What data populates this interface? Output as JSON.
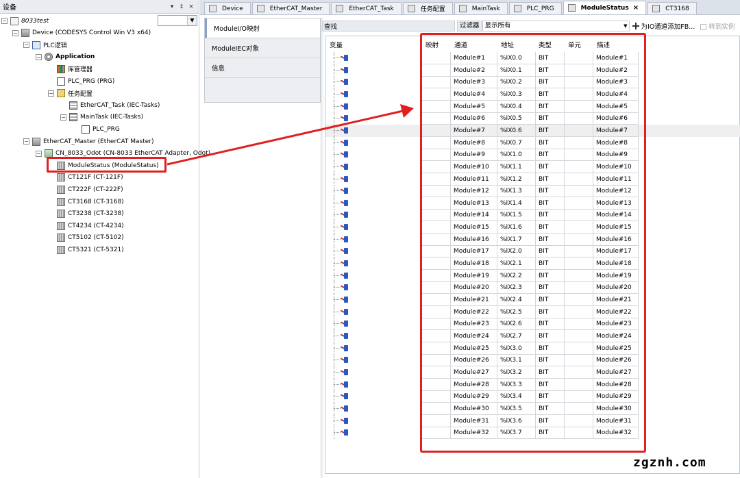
{
  "device_pane": {
    "title": "设备",
    "controls": [
      "▾",
      "‡",
      "×"
    ]
  },
  "tree": [
    {
      "label": "8033test",
      "expander": "−",
      "icon": "project",
      "italic": true
    },
    {
      "label": "Device (CODESYS Control Win V3 x64)",
      "expander": "−",
      "icon": "device"
    },
    {
      "label": "PLC逻辑",
      "expander": "−",
      "icon": "plc-logic"
    },
    {
      "label": "Application",
      "expander": "−",
      "icon": "application",
      "bold": true
    },
    {
      "label": "库管理器",
      "expander": "",
      "icon": "library"
    },
    {
      "label": "PLC_PRG (PRG)",
      "expander": "",
      "icon": "pou"
    },
    {
      "label": "任务配置",
      "expander": "−",
      "icon": "task-config"
    },
    {
      "label": "EtherCAT_Task (IEC-Tasks)",
      "expander": "",
      "icon": "task"
    },
    {
      "label": "MainTask (IEC-Tasks)",
      "expander": "−",
      "icon": "task"
    },
    {
      "label": "PLC_PRG",
      "expander": "",
      "icon": "pou-call"
    },
    {
      "label": "EtherCAT_Master (EtherCAT Master)",
      "expander": "−",
      "icon": "ethercat-master"
    },
    {
      "label": "CN_8033_Odot (CN-8033 EtherCAT Adapter, Odot)",
      "expander": "−",
      "icon": "slave"
    },
    {
      "label": "ModuleStatus (ModuleStatus)",
      "expander": "",
      "icon": "module"
    },
    {
      "label": "CT121F (CT-121F)",
      "expander": "",
      "icon": "module"
    },
    {
      "label": "CT222F (CT-222F)",
      "expander": "",
      "icon": "module"
    },
    {
      "label": "CT3168 (CT-3168)",
      "expander": "",
      "icon": "module"
    },
    {
      "label": "CT3238 (CT-3238)",
      "expander": "",
      "icon": "module"
    },
    {
      "label": "CT4234 (CT-4234)",
      "expander": "",
      "icon": "module"
    },
    {
      "label": "CT5102 (CT-5102)",
      "expander": "",
      "icon": "module"
    },
    {
      "label": "CT5321 (CT-5321)",
      "expander": "",
      "icon": "module"
    }
  ],
  "tabs": [
    {
      "label": "Device"
    },
    {
      "label": "EtherCAT_Master"
    },
    {
      "label": "EtherCAT_Task"
    },
    {
      "label": "任务配置"
    },
    {
      "label": "MainTask"
    },
    {
      "label": "PLC_PRG"
    },
    {
      "label": "ModuleStatus",
      "active": true,
      "close": "×"
    },
    {
      "label": "CT3168"
    }
  ],
  "subtabs": [
    "ModuleI/O映射",
    "ModuleIEC对象",
    "信息"
  ],
  "toolbar": {
    "search_label": "查找",
    "filter_label": "过滤器",
    "filter_value": "显示所有",
    "add_fb": "为IO通道添加FB...",
    "goto_instance": "转到实例"
  },
  "table": {
    "headers": {
      "variable": "变量",
      "mapping": "映射",
      "channel": "通道",
      "address": "地址",
      "type": "类型",
      "unit": "单元",
      "description": "描述"
    },
    "highlighted_row": 7,
    "rows": [
      {
        "channel": "Module#1",
        "address": "%IX0.0",
        "type": "BIT",
        "description": "Module#1"
      },
      {
        "channel": "Module#2",
        "address": "%IX0.1",
        "type": "BIT",
        "description": "Module#2"
      },
      {
        "channel": "Module#3",
        "address": "%IX0.2",
        "type": "BIT",
        "description": "Module#3"
      },
      {
        "channel": "Module#4",
        "address": "%IX0.3",
        "type": "BIT",
        "description": "Module#4"
      },
      {
        "channel": "Module#5",
        "address": "%IX0.4",
        "type": "BIT",
        "description": "Module#5"
      },
      {
        "channel": "Module#6",
        "address": "%IX0.5",
        "type": "BIT",
        "description": "Module#6"
      },
      {
        "channel": "Module#7",
        "address": "%IX0.6",
        "type": "BIT",
        "description": "Module#7"
      },
      {
        "channel": "Module#8",
        "address": "%IX0.7",
        "type": "BIT",
        "description": "Module#8"
      },
      {
        "channel": "Module#9",
        "address": "%IX1.0",
        "type": "BIT",
        "description": "Module#9"
      },
      {
        "channel": "Module#10",
        "address": "%IX1.1",
        "type": "BIT",
        "description": "Module#10"
      },
      {
        "channel": "Module#11",
        "address": "%IX1.2",
        "type": "BIT",
        "description": "Module#11"
      },
      {
        "channel": "Module#12",
        "address": "%IX1.3",
        "type": "BIT",
        "description": "Module#12"
      },
      {
        "channel": "Module#13",
        "address": "%IX1.4",
        "type": "BIT",
        "description": "Module#13"
      },
      {
        "channel": "Module#14",
        "address": "%IX1.5",
        "type": "BIT",
        "description": "Module#14"
      },
      {
        "channel": "Module#15",
        "address": "%IX1.6",
        "type": "BIT",
        "description": "Module#15"
      },
      {
        "channel": "Module#16",
        "address": "%IX1.7",
        "type": "BIT",
        "description": "Module#16"
      },
      {
        "channel": "Module#17",
        "address": "%IX2.0",
        "type": "BIT",
        "description": "Module#17"
      },
      {
        "channel": "Module#18",
        "address": "%IX2.1",
        "type": "BIT",
        "description": "Module#18"
      },
      {
        "channel": "Module#19",
        "address": "%IX2.2",
        "type": "BIT",
        "description": "Module#19"
      },
      {
        "channel": "Module#20",
        "address": "%IX2.3",
        "type": "BIT",
        "description": "Module#20"
      },
      {
        "channel": "Module#21",
        "address": "%IX2.4",
        "type": "BIT",
        "description": "Module#21"
      },
      {
        "channel": "Module#22",
        "address": "%IX2.5",
        "type": "BIT",
        "description": "Module#22"
      },
      {
        "channel": "Module#23",
        "address": "%IX2.6",
        "type": "BIT",
        "description": "Module#23"
      },
      {
        "channel": "Module#24",
        "address": "%IX2.7",
        "type": "BIT",
        "description": "Module#24"
      },
      {
        "channel": "Module#25",
        "address": "%IX3.0",
        "type": "BIT",
        "description": "Module#25"
      },
      {
        "channel": "Module#26",
        "address": "%IX3.1",
        "type": "BIT",
        "description": "Module#26"
      },
      {
        "channel": "Module#27",
        "address": "%IX3.2",
        "type": "BIT",
        "description": "Module#27"
      },
      {
        "channel": "Module#28",
        "address": "%IX3.3",
        "type": "BIT",
        "description": "Module#28"
      },
      {
        "channel": "Module#29",
        "address": "%IX3.4",
        "type": "BIT",
        "description": "Module#29"
      },
      {
        "channel": "Module#30",
        "address": "%IX3.5",
        "type": "BIT",
        "description": "Module#30"
      },
      {
        "channel": "Module#31",
        "address": "%IX3.6",
        "type": "BIT",
        "description": "Module#31"
      },
      {
        "channel": "Module#32",
        "address": "%IX3.7",
        "type": "BIT",
        "description": "Module#32"
      }
    ]
  },
  "annotation_color": "#e02020",
  "watermark": "zgznh.com"
}
